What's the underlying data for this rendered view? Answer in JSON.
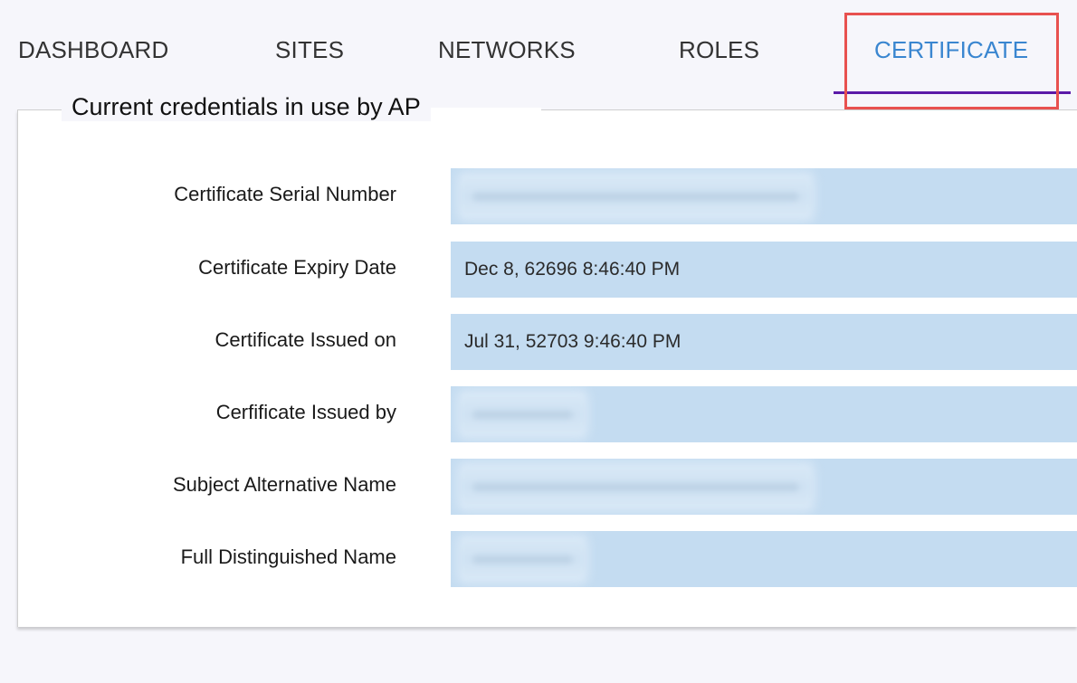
{
  "tabs": [
    {
      "label": "DASHBOARD",
      "active": false
    },
    {
      "label": "SITES",
      "active": false
    },
    {
      "label": "NETWORKS",
      "active": false
    },
    {
      "label": "ROLES",
      "active": false
    },
    {
      "label": "CERTIFICATE",
      "active": true
    }
  ],
  "panel": {
    "title": "Current credentials in use by AP",
    "rows": [
      {
        "label": "Certificate Serial Number",
        "value": "",
        "redacted": true
      },
      {
        "label": "Certificate Expiry Date",
        "value": "Dec 8, 62696 8:46:40 PM",
        "redacted": false
      },
      {
        "label": "Certificate Issued on",
        "value": "Jul 31, 52703 9:46:40 PM",
        "redacted": false
      },
      {
        "label": "Cerfificate Issued by",
        "value": "",
        "redacted": true
      },
      {
        "label": "Subject Alternative Name",
        "value": "",
        "redacted": true
      },
      {
        "label": "Full Distinguished Name",
        "value": "",
        "redacted": true
      }
    ]
  },
  "colors": {
    "active_tab": "#3a86d0",
    "tab_underline": "#5b1aa8",
    "highlight_box": "#e8514f",
    "field_background": "#c4dcf1"
  }
}
